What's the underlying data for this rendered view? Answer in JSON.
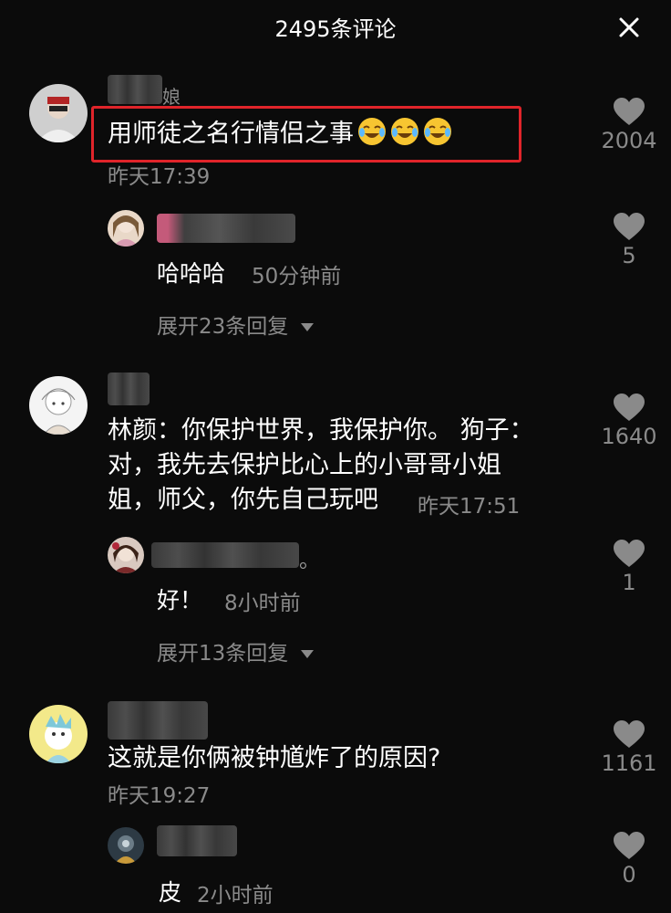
{
  "header": {
    "title": "2495条评论"
  },
  "comments": [
    {
      "nickname_tail": "娘",
      "text": "用师徒之名行情侣之事",
      "emoji_count": 3,
      "time": "昨天17:39",
      "likes": "2004",
      "reply": {
        "nickname_tail": "",
        "text": "哈哈哈",
        "time": "50分钟前",
        "likes": "5"
      },
      "expand": "展开23条回复"
    },
    {
      "text_lines": [
        "林颜：你保护世界，我保护你。 狗子：",
        "对，我先去保护比心上的小哥哥小姐",
        "姐，师父，你先自己玩吧"
      ],
      "time": "昨天17:51",
      "likes": "1640",
      "reply": {
        "nickname_tail": "。",
        "text": "好！",
        "time": "8小时前",
        "likes": "1"
      },
      "expand": "展开13条回复"
    },
    {
      "text": "这就是你俩被钟馗炸了的原因?",
      "time": "昨天19:27",
      "likes": "1161",
      "reply": {
        "text": "皮",
        "time": "2小时前",
        "likes": "0"
      }
    }
  ],
  "colors": {
    "background": "#0b0b0b",
    "meta": "#8a8a8a",
    "highlight": "#e0242a"
  },
  "icons": [
    "close-icon",
    "heart-icon",
    "crying-laughing-emoji",
    "caret-down-icon"
  ]
}
